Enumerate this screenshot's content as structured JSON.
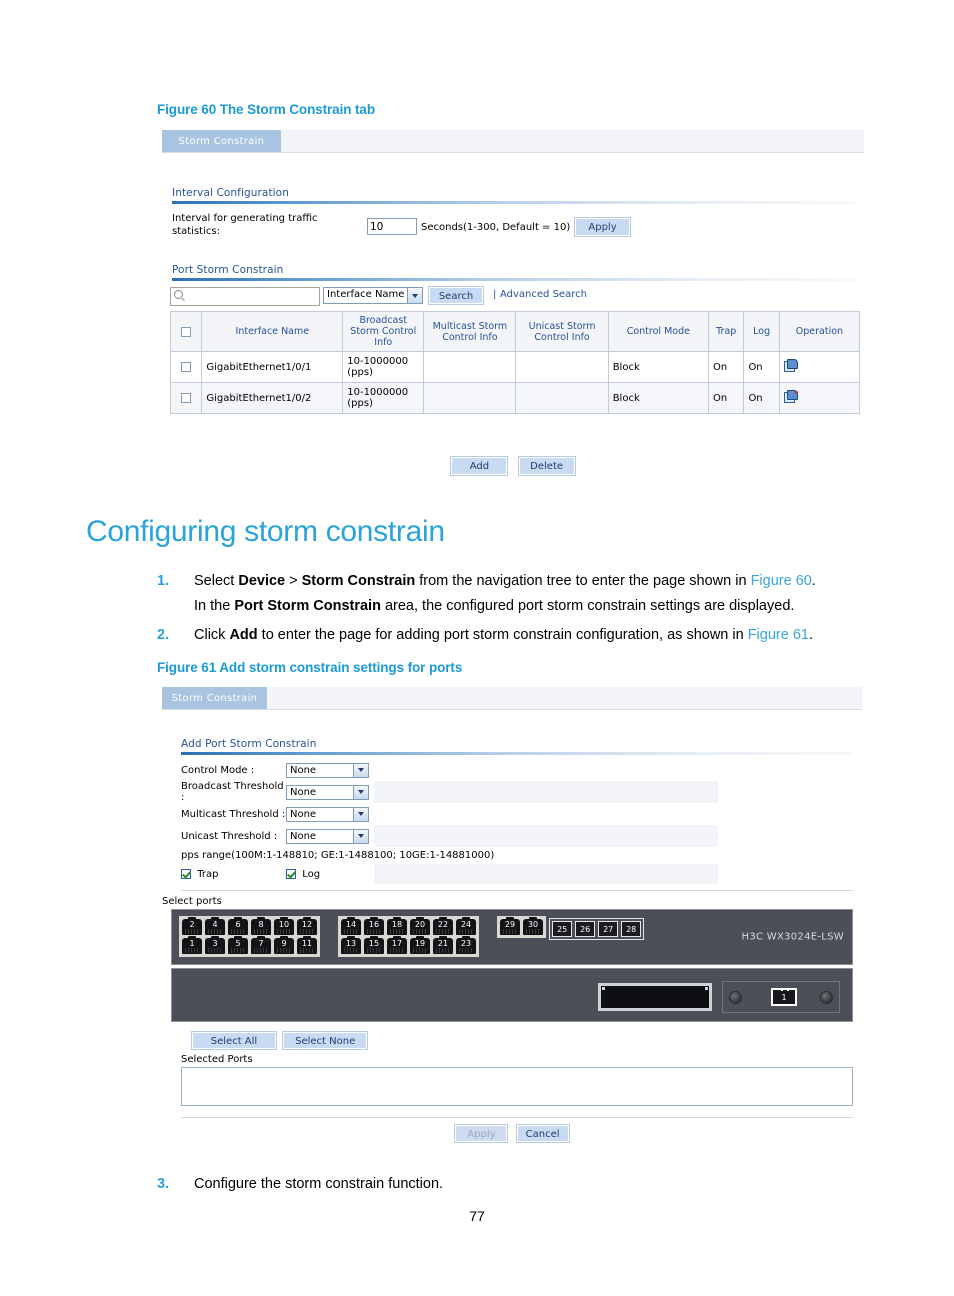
{
  "document": {
    "page_number": "77",
    "heading": "Configuring storm constrain",
    "figure60_caption": "Figure 60 The Storm Constrain tab",
    "figure61_caption": "Figure 61 Add storm constrain settings for ports",
    "steps": [
      {
        "num": "1.",
        "line1_parts": [
          "Select ",
          "Device",
          " > ",
          "Storm Constrain",
          " from the navigation tree to enter the page shown in ",
          "Figure 60",
          "."
        ],
        "line2_parts": [
          "In the ",
          "Port Storm Constrain",
          " area, the configured port storm constrain settings are displayed."
        ]
      },
      {
        "num": "2.",
        "line1_parts": [
          "Click ",
          "Add",
          " to enter the page for adding port storm constrain configuration, as shown in ",
          "Figure 61",
          "."
        ]
      },
      {
        "num": "3.",
        "line1_parts": [
          "Configure the storm constrain function."
        ]
      }
    ]
  },
  "figure60": {
    "tab_label": "Storm Constrain",
    "interval_section": {
      "title": "Interval Configuration",
      "label_line1": "Interval for generating traffic",
      "label_line2": "statistics:",
      "value": "10",
      "unit_hint": "Seconds(1-300, Default = 10)",
      "apply_label": "Apply"
    },
    "port_section": {
      "title": "Port Storm Constrain",
      "search_placeholder": "",
      "search_value": "",
      "search_field_selected": "Interface Name",
      "search_button": "Search",
      "advanced_search": "Advanced Search",
      "separator": "|",
      "columns": [
        "",
        "Interface Name",
        "Broadcast Storm Control Info",
        "Multicast Storm Control Info",
        "Unicast Storm Control Info",
        "Control Mode",
        "Trap",
        "Log",
        "Operation"
      ],
      "rows": [
        {
          "interface": "GigabitEthernet1/0/1",
          "broadcast": "10-1000000 (pps)",
          "multicast": "",
          "unicast": "",
          "control_mode": "Block",
          "trap": "On",
          "log": "On"
        },
        {
          "interface": "GigabitEthernet1/0/2",
          "broadcast": "10-1000000 (pps)",
          "multicast": "",
          "unicast": "",
          "control_mode": "Block",
          "trap": "On",
          "log": "On"
        }
      ],
      "add_label": "Add",
      "delete_label": "Delete"
    }
  },
  "figure61": {
    "tab_label": "Storm Constrain",
    "form": {
      "title": "Add Port Storm Constrain",
      "fields": [
        {
          "label": "Control Mode :",
          "value": "None"
        },
        {
          "label": "Broadcast Threshold :",
          "value": "None"
        },
        {
          "label": "Multicast Threshold :",
          "value": "None"
        },
        {
          "label": "Unicast Threshold :",
          "value": "None"
        }
      ],
      "pps_range": "pps range(100M:1-148810; GE:1-1488100; 10GE:1-14881000)",
      "trap_label": "Trap",
      "trap_checked": true,
      "log_label": "Log",
      "log_checked": true
    },
    "select_ports": {
      "label": "Select ports",
      "device_name": "H3C WX3024E-LSW",
      "group1_top": [
        "2",
        "4",
        "6",
        "8",
        "10",
        "12"
      ],
      "group1_bottom": [
        "1",
        "3",
        "5",
        "7",
        "9",
        "11"
      ],
      "group2_top": [
        "14",
        "16",
        "18",
        "20",
        "22",
        "24"
      ],
      "group2_bottom": [
        "13",
        "15",
        "17",
        "19",
        "21",
        "23"
      ],
      "group3_top": [
        "29",
        "30"
      ],
      "group3_bottom": [
        "25",
        "26",
        "27",
        "28"
      ],
      "console_port_label": "1",
      "select_all_label": "Select All",
      "select_none_label": "Select None",
      "selected_ports_label": "Selected Ports",
      "selected_ports_value": ""
    },
    "apply_label": "Apply",
    "cancel_label": "Cancel"
  },
  "colors": {
    "accent_blue": "#2aa3dd",
    "tab_blue": "#a8c4e0",
    "section_title": "#26529c",
    "button_fill": "#cfdcf0"
  }
}
